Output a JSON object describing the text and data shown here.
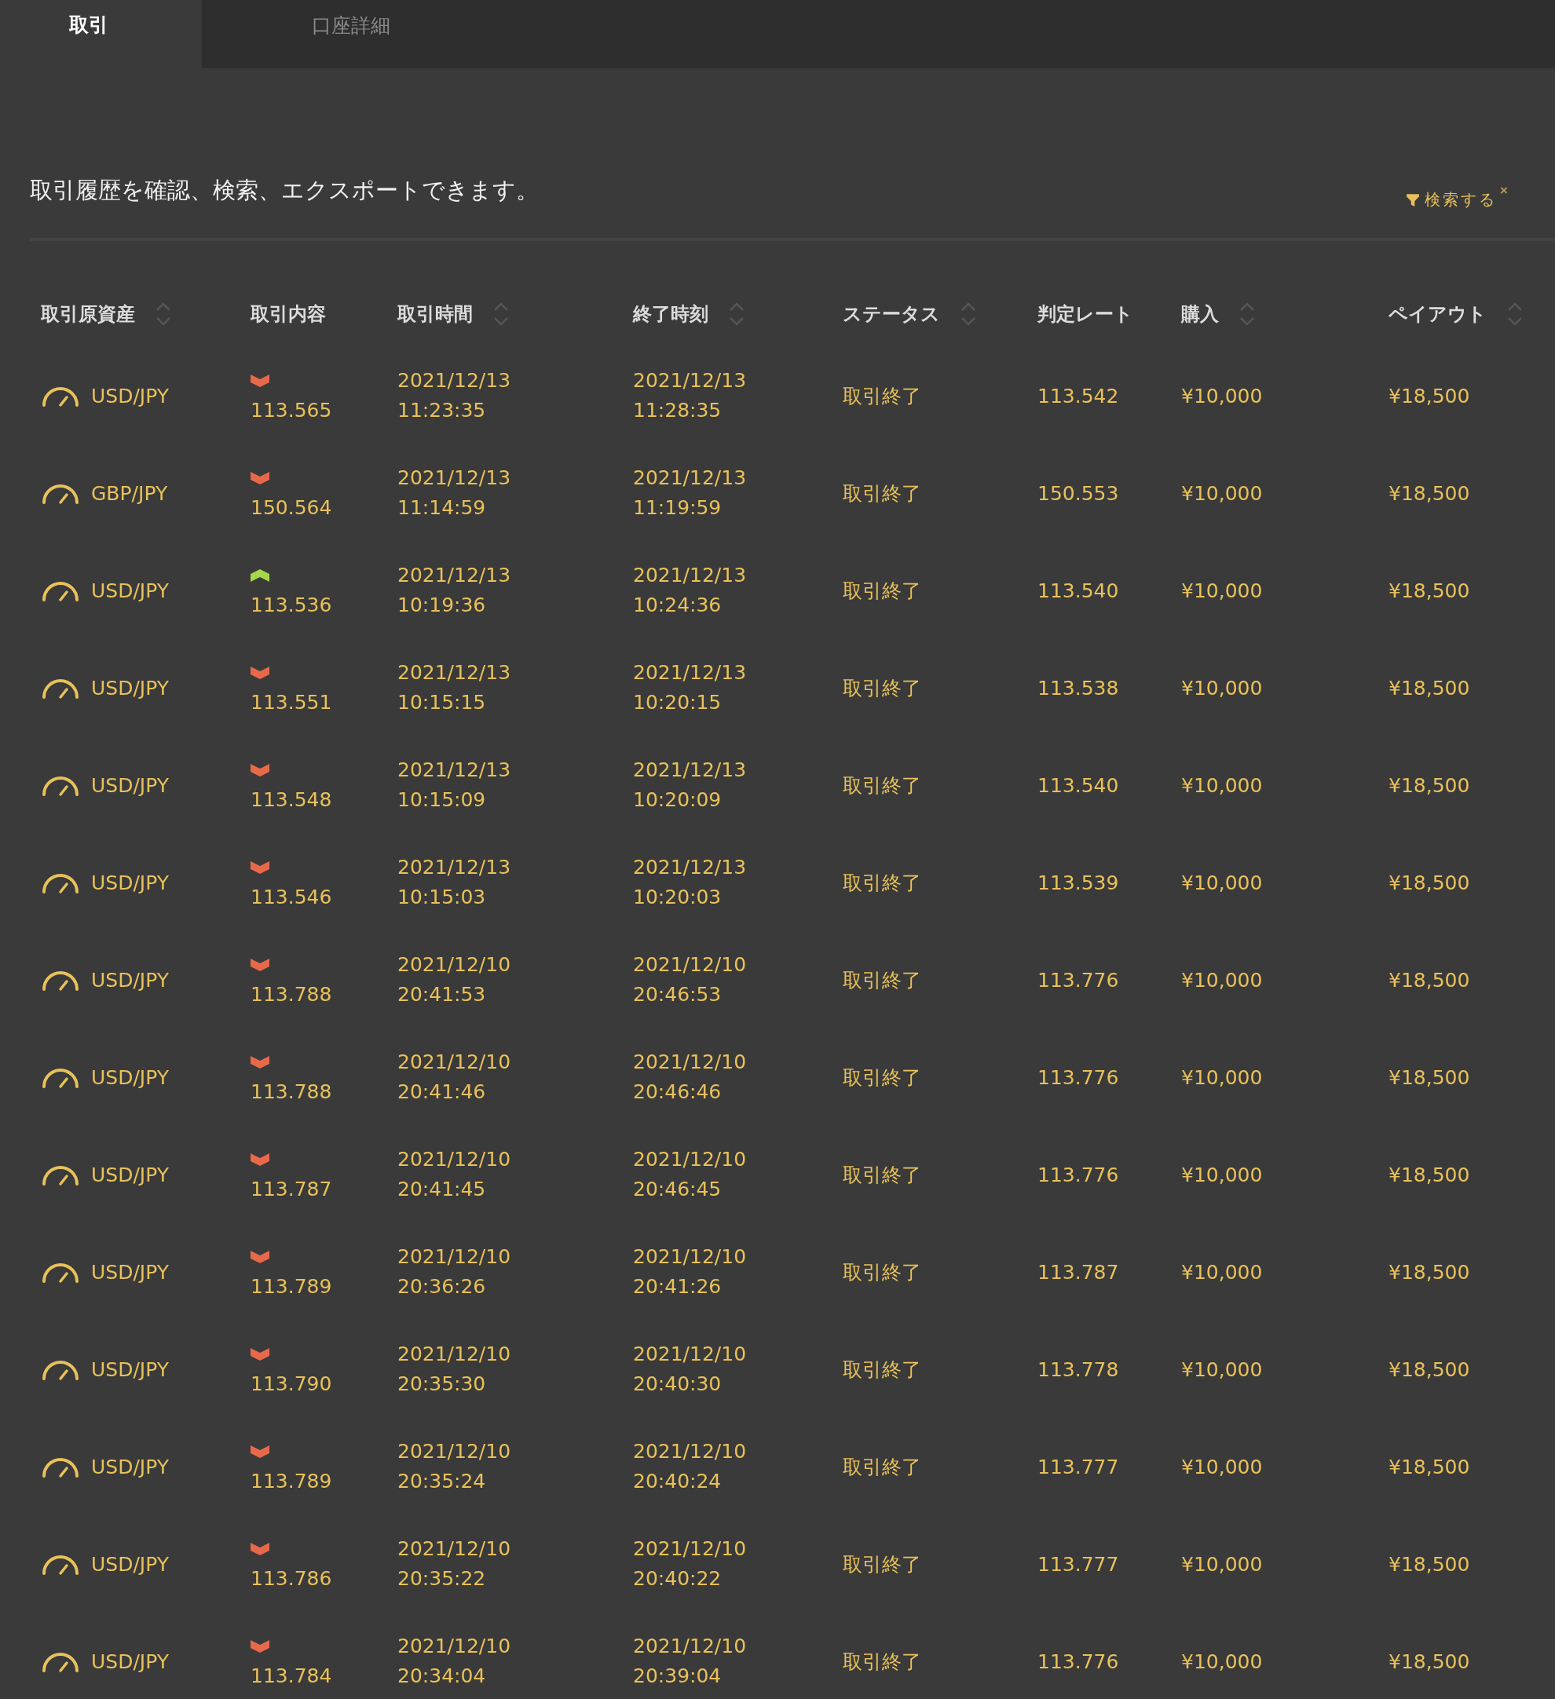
{
  "tabs": [
    {
      "label": "取引",
      "selected": true
    },
    {
      "label": "口座詳細",
      "selected": false
    }
  ],
  "description": "取引履歴を確認、検索、エクスポートできます。",
  "filter": {
    "label": "検索する",
    "clear": "×"
  },
  "columns": [
    {
      "label": "取引原資産",
      "sortable": true
    },
    {
      "label": "取引内容",
      "sortable": false
    },
    {
      "label": "取引時間",
      "sortable": true
    },
    {
      "label": "終了時刻",
      "sortable": true
    },
    {
      "label": "ステータス",
      "sortable": true
    },
    {
      "label": "判定レート",
      "sortable": false
    },
    {
      "label": "購入",
      "sortable": true
    },
    {
      "label": "ペイアウト",
      "sortable": true
    }
  ],
  "rows": [
    {
      "asset": "USD/JPY",
      "kind": "down",
      "price": "113.565",
      "trade_date": "2021/12/13",
      "trade_time": "11:23:35",
      "end_date": "2021/12/13",
      "end_time": "11:28:35",
      "status": "取引終了",
      "rate": "113.542",
      "purchase": "¥10,000",
      "payout": "¥18,500"
    },
    {
      "asset": "GBP/JPY",
      "kind": "down",
      "price": "150.564",
      "trade_date": "2021/12/13",
      "trade_time": "11:14:59",
      "end_date": "2021/12/13",
      "end_time": "11:19:59",
      "status": "取引終了",
      "rate": "150.553",
      "purchase": "¥10,000",
      "payout": "¥18,500"
    },
    {
      "asset": "USD/JPY",
      "kind": "up",
      "price": "113.536",
      "trade_date": "2021/12/13",
      "trade_time": "10:19:36",
      "end_date": "2021/12/13",
      "end_time": "10:24:36",
      "status": "取引終了",
      "rate": "113.540",
      "purchase": "¥10,000",
      "payout": "¥18,500"
    },
    {
      "asset": "USD/JPY",
      "kind": "down",
      "price": "113.551",
      "trade_date": "2021/12/13",
      "trade_time": "10:15:15",
      "end_date": "2021/12/13",
      "end_time": "10:20:15",
      "status": "取引終了",
      "rate": "113.538",
      "purchase": "¥10,000",
      "payout": "¥18,500"
    },
    {
      "asset": "USD/JPY",
      "kind": "down",
      "price": "113.548",
      "trade_date": "2021/12/13",
      "trade_time": "10:15:09",
      "end_date": "2021/12/13",
      "end_time": "10:20:09",
      "status": "取引終了",
      "rate": "113.540",
      "purchase": "¥10,000",
      "payout": "¥18,500"
    },
    {
      "asset": "USD/JPY",
      "kind": "down",
      "price": "113.546",
      "trade_date": "2021/12/13",
      "trade_time": "10:15:03",
      "end_date": "2021/12/13",
      "end_time": "10:20:03",
      "status": "取引終了",
      "rate": "113.539",
      "purchase": "¥10,000",
      "payout": "¥18,500"
    },
    {
      "asset": "USD/JPY",
      "kind": "down",
      "price": "113.788",
      "trade_date": "2021/12/10",
      "trade_time": "20:41:53",
      "end_date": "2021/12/10",
      "end_time": "20:46:53",
      "status": "取引終了",
      "rate": "113.776",
      "purchase": "¥10,000",
      "payout": "¥18,500"
    },
    {
      "asset": "USD/JPY",
      "kind": "down",
      "price": "113.788",
      "trade_date": "2021/12/10",
      "trade_time": "20:41:46",
      "end_date": "2021/12/10",
      "end_time": "20:46:46",
      "status": "取引終了",
      "rate": "113.776",
      "purchase": "¥10,000",
      "payout": "¥18,500"
    },
    {
      "asset": "USD/JPY",
      "kind": "down",
      "price": "113.787",
      "trade_date": "2021/12/10",
      "trade_time": "20:41:45",
      "end_date": "2021/12/10",
      "end_time": "20:46:45",
      "status": "取引終了",
      "rate": "113.776",
      "purchase": "¥10,000",
      "payout": "¥18,500"
    },
    {
      "asset": "USD/JPY",
      "kind": "down",
      "price": "113.789",
      "trade_date": "2021/12/10",
      "trade_time": "20:36:26",
      "end_date": "2021/12/10",
      "end_time": "20:41:26",
      "status": "取引終了",
      "rate": "113.787",
      "purchase": "¥10,000",
      "payout": "¥18,500"
    },
    {
      "asset": "USD/JPY",
      "kind": "down",
      "price": "113.790",
      "trade_date": "2021/12/10",
      "trade_time": "20:35:30",
      "end_date": "2021/12/10",
      "end_time": "20:40:30",
      "status": "取引終了",
      "rate": "113.778",
      "purchase": "¥10,000",
      "payout": "¥18,500"
    },
    {
      "asset": "USD/JPY",
      "kind": "down",
      "price": "113.789",
      "trade_date": "2021/12/10",
      "trade_time": "20:35:24",
      "end_date": "2021/12/10",
      "end_time": "20:40:24",
      "status": "取引終了",
      "rate": "113.777",
      "purchase": "¥10,000",
      "payout": "¥18,500"
    },
    {
      "asset": "USD/JPY",
      "kind": "down",
      "price": "113.786",
      "trade_date": "2021/12/10",
      "trade_time": "20:35:22",
      "end_date": "2021/12/10",
      "end_time": "20:40:22",
      "status": "取引終了",
      "rate": "113.777",
      "purchase": "¥10,000",
      "payout": "¥18,500"
    },
    {
      "asset": "USD/JPY",
      "kind": "down",
      "price": "113.784",
      "trade_date": "2021/12/10",
      "trade_time": "20:34:04",
      "end_date": "2021/12/10",
      "end_time": "20:39:04",
      "status": "取引終了",
      "rate": "113.776",
      "purchase": "¥10,000",
      "payout": "¥18,500"
    }
  ]
}
